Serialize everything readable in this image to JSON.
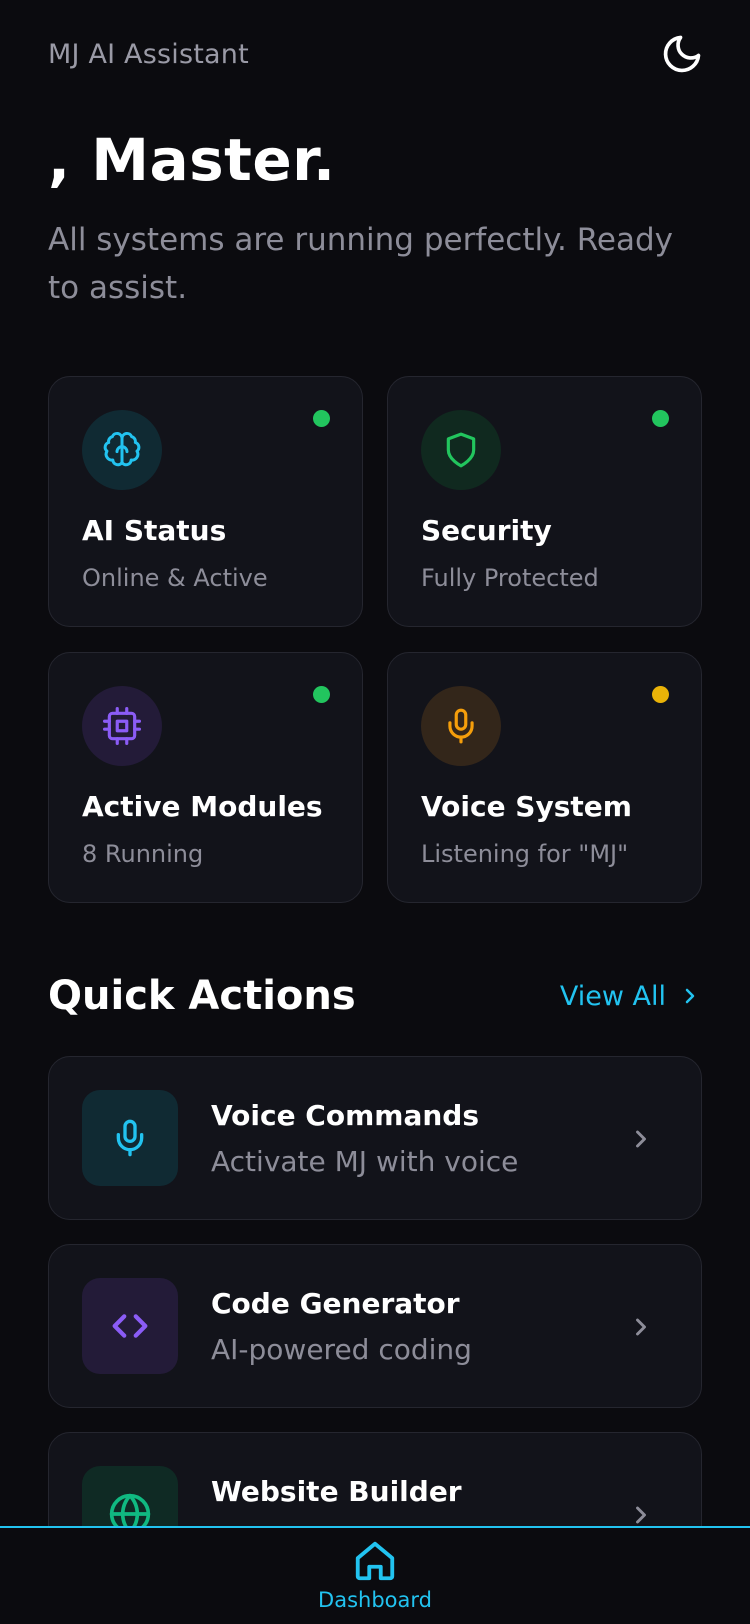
{
  "header": {
    "app_title": "MJ AI Assistant",
    "theme_icon": "moon-icon"
  },
  "hero": {
    "greeting": ", Master.",
    "subtitle": "All systems are running perfectly. Ready to assist."
  },
  "status_cards": [
    {
      "title": "AI Status",
      "subtitle": "Online & Active",
      "icon": "brain-icon",
      "accent": "#22c3f0",
      "dot_color": "#22c55e"
    },
    {
      "title": "Security",
      "subtitle": "Fully Protected",
      "icon": "shield-icon",
      "accent": "#22c55e",
      "dot_color": "#22c55e"
    },
    {
      "title": "Active Modules",
      "subtitle": "8 Running",
      "icon": "cpu-icon",
      "accent": "#8b5cf6",
      "dot_color": "#22c55e"
    },
    {
      "title": "Voice System",
      "subtitle": "Listening for \"MJ\"",
      "icon": "microphone-icon",
      "accent": "#f59e0b",
      "dot_color": "#eab308"
    }
  ],
  "quick_actions": {
    "title": "Quick Actions",
    "view_all_label": "View All",
    "items": [
      {
        "title": "Voice Commands",
        "subtitle": "Activate MJ with voice",
        "icon": "microphone-icon",
        "accent": "#22c3f0"
      },
      {
        "title": "Code Generator",
        "subtitle": "AI-powered coding",
        "icon": "code-icon",
        "accent": "#8b5cf6"
      },
      {
        "title": "Website Builder",
        "subtitle": "",
        "icon": "globe-icon",
        "accent": "#10b981"
      }
    ]
  },
  "bottom_nav": {
    "items": [
      {
        "label": "Dashboard",
        "icon": "home-icon",
        "active": true
      }
    ]
  },
  "colors": {
    "background": "#0b0b0f",
    "card": "#12131a",
    "accent": "#22c3f0",
    "muted_text": "#8d8d99"
  }
}
